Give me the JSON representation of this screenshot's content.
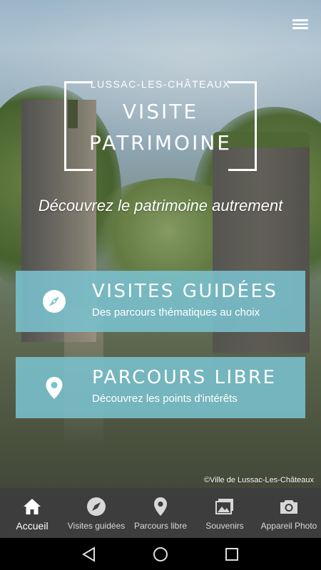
{
  "header": {
    "city": "LUSSAC-LES-CHÂTEAUX",
    "title_line1": "VISITE",
    "title_line2": "PATRIMOINE",
    "tagline": "Découvrez le patrimoine autrement"
  },
  "cards": [
    {
      "title": "VISITES GUIDÉES",
      "subtitle": "Des parcours thématiques au choix",
      "icon": "compass-icon"
    },
    {
      "title": "PARCOURS LIBRE",
      "subtitle": "Découvrez les points d'intérêts",
      "icon": "map-pin-icon"
    }
  ],
  "copyright": "©Ville de Lussac-Les-Châteaux",
  "tabs": [
    {
      "label": "Accueil",
      "icon": "home-icon",
      "active": true
    },
    {
      "label": "Visites guidées",
      "icon": "compass-icon",
      "active": false
    },
    {
      "label": "Parcours libre",
      "icon": "map-pin-icon",
      "active": false
    },
    {
      "label": "Souvenirs",
      "icon": "photos-icon",
      "active": false
    },
    {
      "label": "Appareil Photo",
      "icon": "camera-icon",
      "active": false
    }
  ],
  "colors": {
    "card_bg": "#7ac2ce",
    "tabbar_bg": "#3d3d3d",
    "nav_bg": "#000000"
  }
}
